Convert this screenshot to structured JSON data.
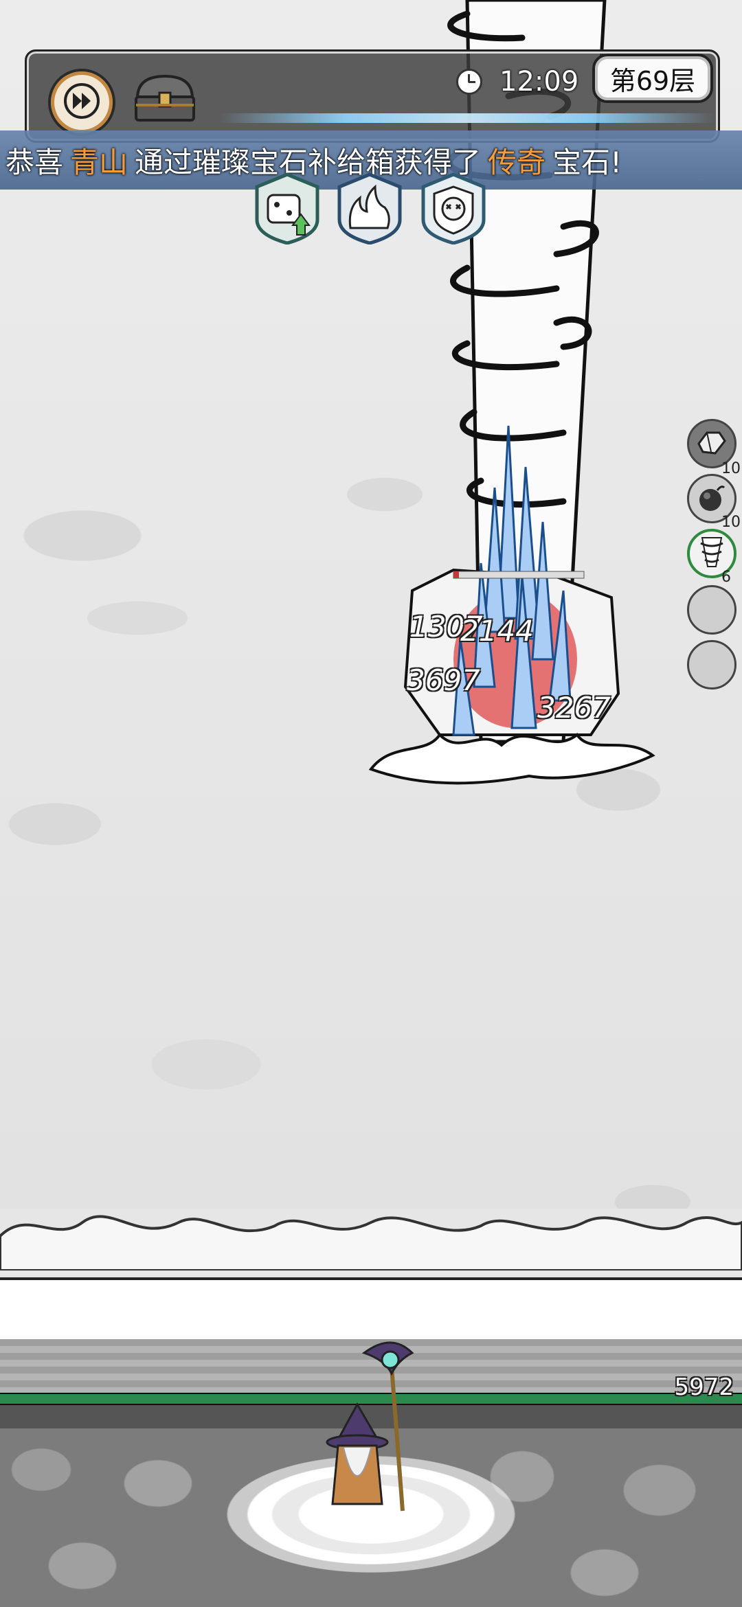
{
  "hud": {
    "time": "12:09",
    "floor": "第69层",
    "fast_forward_icon": "fast-forward-icon",
    "chest_icon": "treasure-chest-icon"
  },
  "announcement": {
    "prefix": "恭喜",
    "player": "青山",
    "middle": "通过璀璨宝石补给箱获得了",
    "rarity": "传奇",
    "suffix": "宝石!",
    "highlight_color": "#f49b3a"
  },
  "skills": [
    {
      "icon": "dice-upgrade-skill-icon"
    },
    {
      "icon": "flame-skill-icon"
    },
    {
      "icon": "skull-shield-skill-icon"
    }
  ],
  "resources": [
    {
      "icon": "crystal-icon",
      "count": "10"
    },
    {
      "icon": "bomb-icon",
      "count": "10"
    },
    {
      "icon": "tornado-icon",
      "count": "6"
    },
    {
      "icon": "empty-slot-icon",
      "count": ""
    },
    {
      "icon": "empty-slot-icon",
      "count": ""
    }
  ],
  "damage_numbers": [
    "1307",
    "2144",
    "3697",
    "3267"
  ],
  "wall": {
    "hp": "5972"
  },
  "colors": {
    "banner": "#5b7aa3",
    "hp_bar": "#2d8a4e",
    "accent_orange": "#f49b3a"
  }
}
